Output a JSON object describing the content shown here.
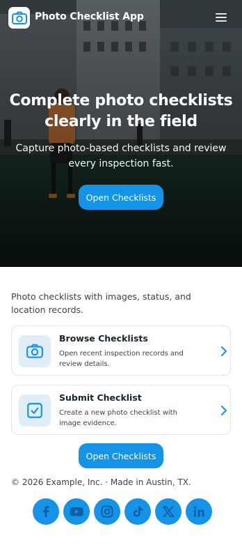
{
  "header": {
    "app_title": "Photo Checklist App",
    "logo_icon": "camera-icon",
    "menu_icon": "hamburger-menu-icon"
  },
  "hero": {
    "title": "Complete photo checklists clearly in the field",
    "subtitle": "Capture photo-based checklists and review every inspection fast.",
    "cta_label": "Open Checklists"
  },
  "main": {
    "intro": "Photo checklists with images, status, and location records.",
    "cards": [
      {
        "title": "Browse Checklists",
        "description": "Open recent inspection records and review details.",
        "icon": "camera-icon",
        "chevron_icon": "chevron-right-icon"
      },
      {
        "title": "Submit Checklist",
        "description": "Create a new photo checklist with image evidence.",
        "icon": "checkbox-icon",
        "chevron_icon": "chevron-right-icon"
      }
    ],
    "cta_label": "Open Checklists"
  },
  "footer": {
    "text": "© 2026 Example, Inc. · Made in Austin, TX.",
    "socials": [
      "facebook-icon",
      "youtube-icon",
      "instagram-icon",
      "tiktok-icon",
      "x-icon",
      "linkedin-icon"
    ]
  },
  "colors": {
    "accent": "#1593e6",
    "icon_tile": "#e1eef9",
    "card_border": "#e2e6ea",
    "social_glyph": "#0d5fa6"
  }
}
